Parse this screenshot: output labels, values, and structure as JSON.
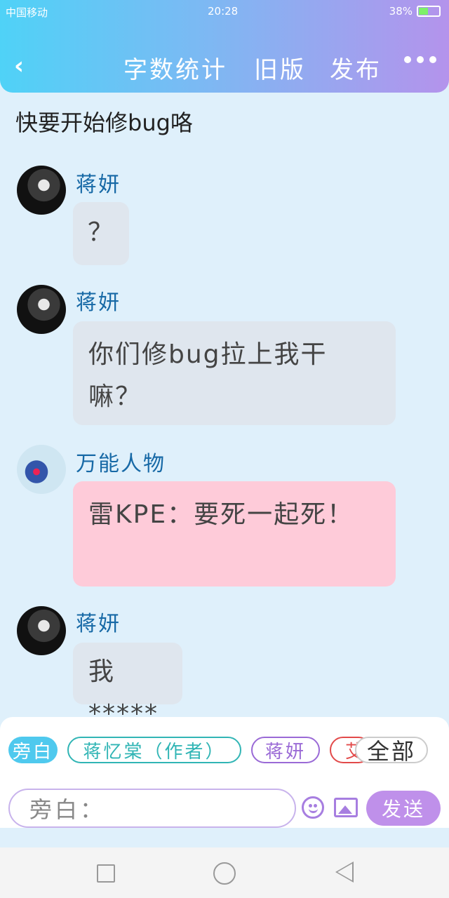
{
  "status_bar": {
    "network": "中国移动",
    "time": "20:28",
    "battery": "38%"
  },
  "header": {
    "back_icon": "chevron-left-icon",
    "word_count": "字数统计",
    "old_version": "旧版",
    "publish": "发布",
    "more_icon": "more-dots-icon"
  },
  "chat_title": "快要开始修bug咯",
  "messages": [
    {
      "name": "蒋妍",
      "text": "？",
      "color": "gray"
    },
    {
      "name": "蒋妍",
      "text": "你们修bug拉上我干嘛？",
      "color": "gray"
    },
    {
      "name": "万能人物",
      "text": "雷KPE：要死一起死！",
      "color": "pink"
    },
    {
      "name": "蒋妍",
      "text": "我*****",
      "color": "gray"
    }
  ],
  "roles": {
    "aside": "旁白",
    "author": "蒋忆棠（作者）",
    "jiang": "蒋妍",
    "partial": "艾",
    "all": "全部"
  },
  "input": {
    "prefix": "旁白："
  },
  "send_label": "发送",
  "colors": {
    "accent": "#bf90ea",
    "gradient_start": "#4fd2f7",
    "gradient_end": "#b493ec",
    "bubble_pink": "#fecbd9",
    "bubble_gray": "#dfe6ee"
  }
}
